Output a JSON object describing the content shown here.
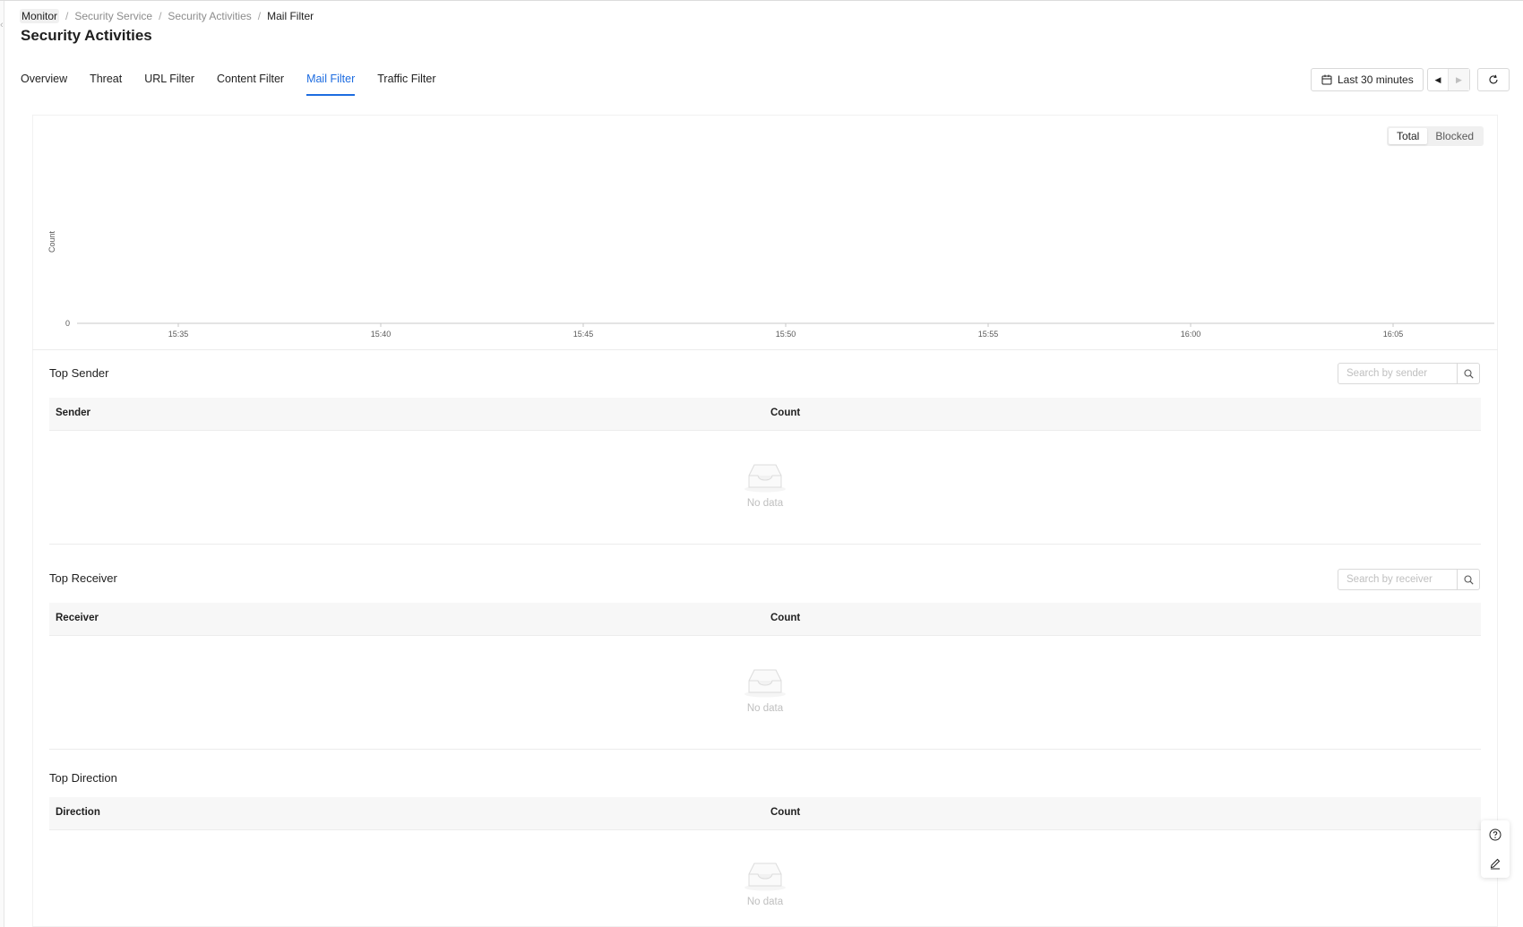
{
  "breadcrumb": [
    "Monitor",
    "Security Service",
    "Security Activities",
    "Mail Filter"
  ],
  "page_title": "Security Activities",
  "tabs": [
    {
      "label": "Overview",
      "active": false
    },
    {
      "label": "Threat",
      "active": false
    },
    {
      "label": "URL Filter",
      "active": false
    },
    {
      "label": "Content Filter",
      "active": false
    },
    {
      "label": "Mail Filter",
      "active": true
    },
    {
      "label": "Traffic Filter",
      "active": false
    }
  ],
  "toolbar": {
    "time_range_label": "Last 30 minutes",
    "calendar_icon": "calendar-icon",
    "prev_icon": "caret-left-icon",
    "next_icon": "caret-right-icon",
    "refresh_icon": "refresh-icon"
  },
  "chart_toggle": {
    "options": [
      "Total",
      "Blocked"
    ],
    "selected": "Total"
  },
  "chart_data": {
    "type": "line",
    "ylabel": "Count",
    "xlabel": "",
    "y_ticks": [
      "0"
    ],
    "x_ticks": [
      "15:35",
      "15:40",
      "15:45",
      "15:50",
      "15:55",
      "16:00",
      "16:05"
    ],
    "series": [],
    "grid": false
  },
  "sections": {
    "sender": {
      "title": "Top Sender",
      "search_placeholder": "Search by sender",
      "columns": [
        "Sender",
        "Count"
      ],
      "empty_text": "No data"
    },
    "receiver": {
      "title": "Top Receiver",
      "search_placeholder": "Search by receiver",
      "columns": [
        "Receiver",
        "Count"
      ],
      "empty_text": "No data"
    },
    "direction": {
      "title": "Top Direction",
      "columns": [
        "Direction",
        "Count"
      ],
      "empty_text": "No data"
    }
  },
  "colors": {
    "accent": "#1d6ce0",
    "text": "#1f1f1f",
    "muted": "#8c8c8c",
    "border": "#d9d9d9",
    "header_bg": "#f7f7f7"
  },
  "float_tools": [
    "help-icon",
    "edit-icon"
  ]
}
